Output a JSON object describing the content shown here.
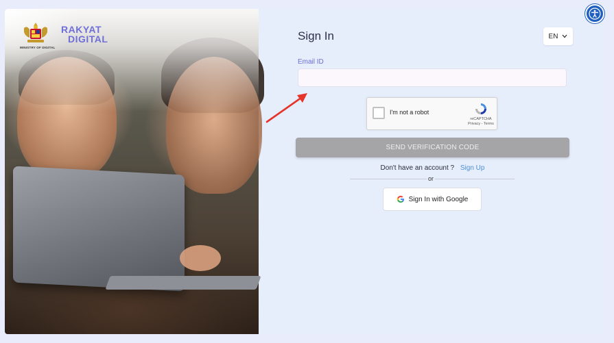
{
  "header": {
    "brand_line1": "RAKYAT",
    "brand_line2": "DIGITAL",
    "ministry": "MINISTRY OF DIGITAL"
  },
  "form": {
    "title": "Sign In",
    "language": "EN",
    "email_label": "Email ID",
    "email_value": "",
    "send_button": "SEND VERIFICATION CODE",
    "no_account_text": "Don't have an account ?",
    "signup_link": "Sign Up",
    "or_text": "or",
    "google_button": "Sign In with Google"
  },
  "captcha": {
    "label": "I'm not a robot",
    "brand": "reCAPTCHA",
    "links": "Privacy - Terms"
  },
  "icons": {
    "accessibility": "accessibility-icon",
    "google": "google-icon",
    "recaptcha": "recaptcha-icon",
    "language_chevron": "chevron-down-icon",
    "annotation_arrow": "arrow-icon"
  },
  "colors": {
    "brand": "#6f6fd8",
    "link": "#4d8fd9",
    "button_disabled": "#a5a5a7",
    "accessibility": "#1f5fbf",
    "arrow": "#e5342a"
  }
}
